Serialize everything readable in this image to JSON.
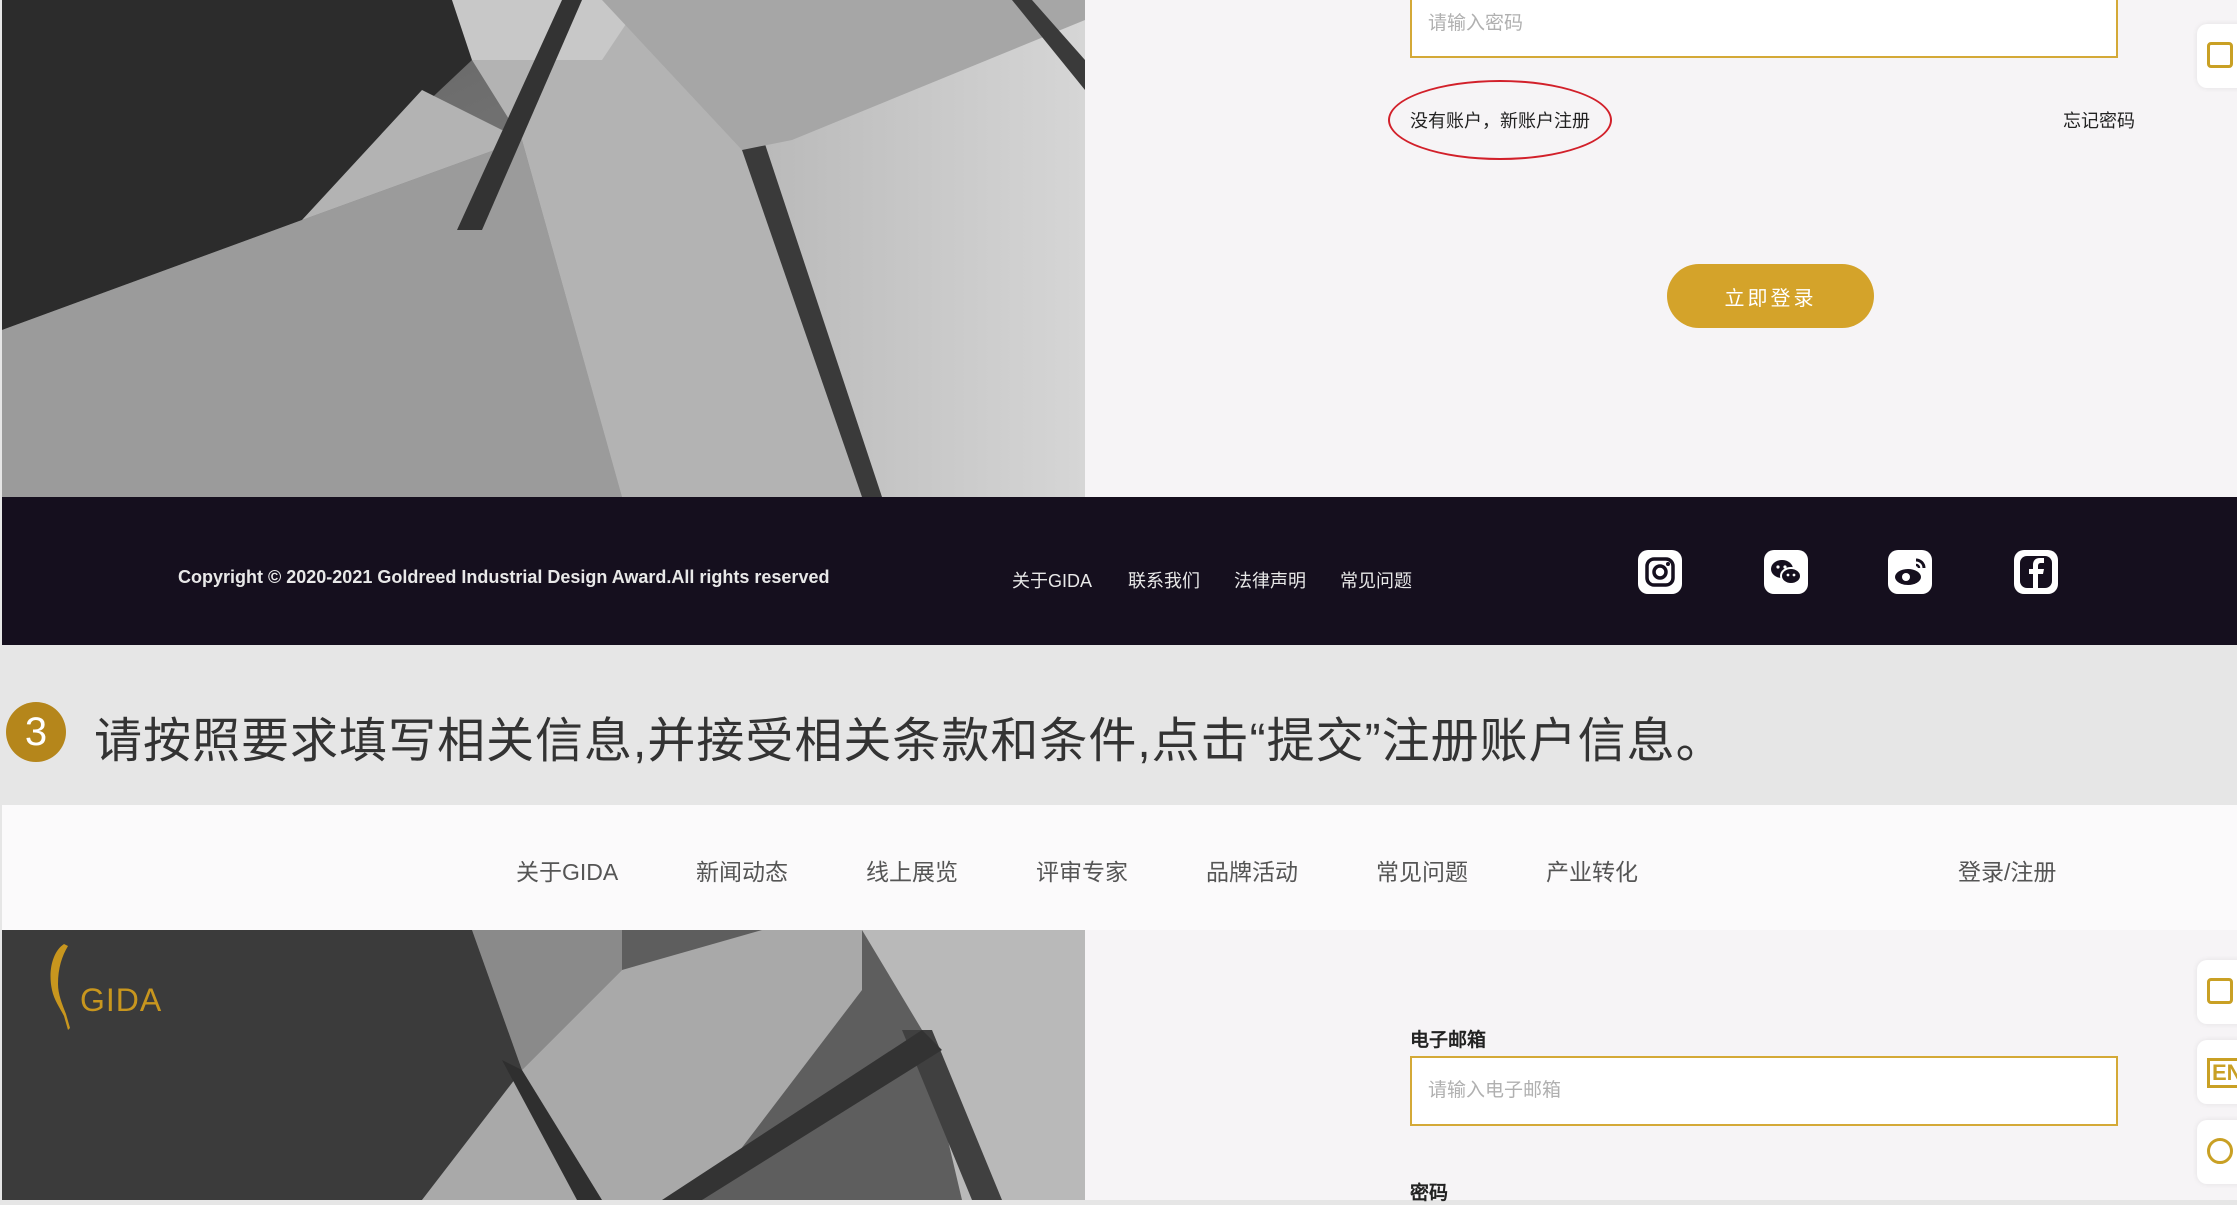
{
  "login": {
    "password_placeholder": "请输入密码",
    "register_link": "没有账户，新账户注册",
    "forgot_link": "忘记密码",
    "login_button": "立即登录"
  },
  "footer": {
    "copyright": "Copyright © 2020-2021 Goldreed Industrial Design Award.All rights reserved",
    "links": [
      "关于GIDA",
      "联系我们",
      "法律声明",
      "常见问题"
    ],
    "social_icons": [
      "instagram-icon",
      "wechat-icon",
      "weibo-icon",
      "facebook-icon"
    ]
  },
  "instruction": {
    "step_number": "3",
    "text": "请按照要求填写相关信息,并接受相关条款和条件,点击“提交”注册账户信息。"
  },
  "nav": {
    "items": [
      "关于GIDA",
      "新闻动态",
      "线上展览",
      "评审专家",
      "品牌活动",
      "常见问题",
      "产业转化"
    ],
    "login_register": "登录/注册"
  },
  "logo": {
    "text": "GIDA"
  },
  "register": {
    "email_label": "电子邮箱",
    "email_placeholder": "请输入电子邮箱",
    "password_label": "密码"
  },
  "rail": {
    "en_label": "EN"
  },
  "colors": {
    "gold": "#d4a32a",
    "footer_bg": "#150f1e",
    "highlight_red": "#d2202a"
  }
}
